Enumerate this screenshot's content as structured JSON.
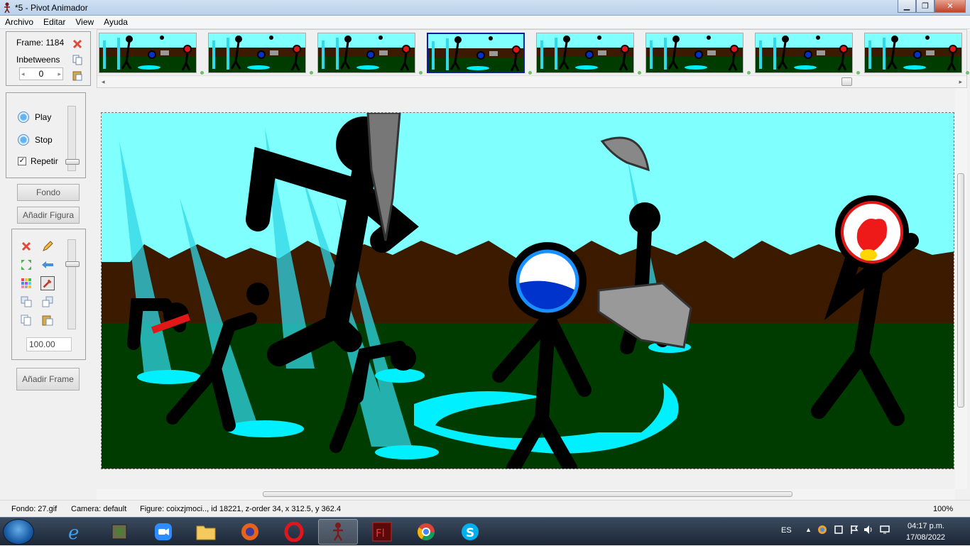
{
  "window": {
    "title": "*5 - Pivot Animador",
    "minimize_icon": "minimize-icon",
    "maximize_icon": "maximize-icon",
    "close_icon": "close-icon"
  },
  "menu": [
    "Archivo",
    "Editar",
    "View",
    "Ayuda"
  ],
  "frame_panel": {
    "frame_label": "Frame: 1184",
    "inbetweens_label": "Inbetweens",
    "inbetweens_value": "0"
  },
  "playback": {
    "play_label": "Play",
    "stop_label": "Stop",
    "repeat_label": "Repetir",
    "repeat_checked": true
  },
  "buttons": {
    "background": "Fondo",
    "add_figure": "Añadir Figura",
    "add_frame": "Añadir Frame"
  },
  "tools": {
    "scale_value": "100.00",
    "selected_tool": "color-picker-icon"
  },
  "timeline": {
    "thumbnail_count": 8,
    "selected_index": 3
  },
  "colors": {
    "sky": "#80ffff",
    "dirt": "#3b1a00",
    "grass": "#003c00",
    "selected_frame_border": "#0b1fa3"
  },
  "status": {
    "background_file": "Fondo: 27.gif",
    "camera": "Camera: default",
    "figure": "Figure: coixzjmoci..,  id 18221,  z-order 34,  x 312.5, y 362.4",
    "zoom": "100%"
  },
  "taskbar": {
    "apps": [
      "ie-icon",
      "minecraft-icon",
      "zoom-icon",
      "file-explorer-icon",
      "firefox-icon",
      "opera-icon",
      "pivot-icon",
      "flash-icon",
      "chrome-icon",
      "skype-icon"
    ],
    "language": "ES",
    "time": "04:17 p.m.",
    "date": "17/08/2022"
  }
}
